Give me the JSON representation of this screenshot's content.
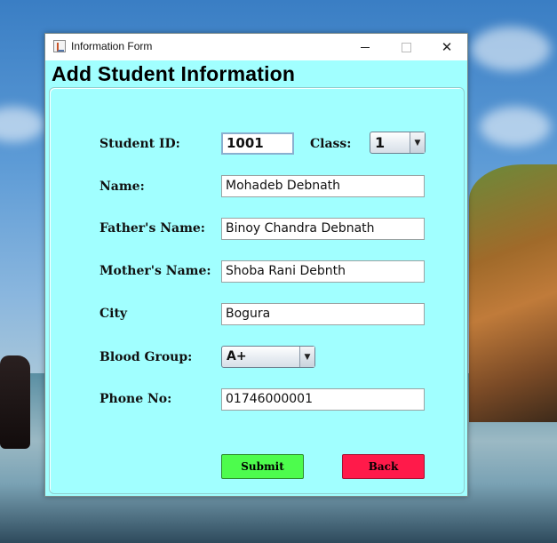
{
  "window": {
    "title": "Information Form",
    "close_glyph": "✕"
  },
  "form": {
    "heading": "Add Student Information",
    "student_id": {
      "label": "Student ID:",
      "value": "1001"
    },
    "class": {
      "label": "Class:",
      "value": "1"
    },
    "name": {
      "label": "Name:",
      "value": "Mohadeb Debnath"
    },
    "father_name": {
      "label": "Father's Name:",
      "value": "Binoy Chandra Debnath"
    },
    "mother_name": {
      "label": "Mother's Name:",
      "value": "Shoba Rani Debnth"
    },
    "city": {
      "label": "City",
      "value": "Bogura"
    },
    "blood_group": {
      "label": "Blood Group:",
      "value": "A+"
    },
    "phone": {
      "label": "Phone No:",
      "value": "01746000001"
    },
    "submit_label": "Submit",
    "back_label": "Back"
  },
  "colors": {
    "form_background": "#a1ffff",
    "submit_button": "#4dfc4d",
    "back_button": "#ff1a4a"
  },
  "icons": {
    "app": "java-cup-icon",
    "minimize": "minimize-icon",
    "maximize": "maximize-icon",
    "close": "close-icon",
    "dropdown": "chevron-down-icon"
  }
}
